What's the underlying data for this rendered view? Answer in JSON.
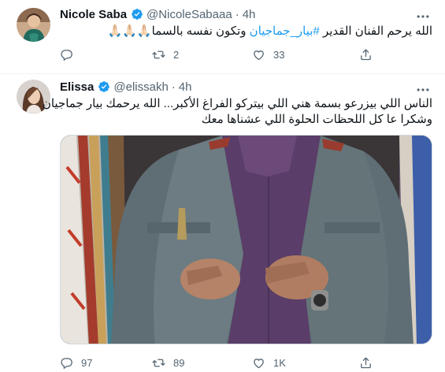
{
  "tweets": [
    {
      "name": "Nicole Saba",
      "handle": "@NicoleSabaaa",
      "dot": "·",
      "time": "4h",
      "text_plain": "الله يرحم الفنان القدير ",
      "hashtag": "#بيار_جماجيان",
      "text_after": " وتكون نفسه بالسما🙏🏻🙏🏻🙏🏻",
      "replies": "",
      "retweets": "2",
      "likes": "33"
    },
    {
      "name": "Elissa",
      "handle": "@elissakh",
      "dot": "·",
      "time": "4h",
      "line1": "الناس اللي بيزرعو بسمة هني اللي بيتركو الفراغ الأكبر... الله يرحمك بيار جماجيان",
      "line2": "وشكرا عا كل اللحظات الحلوة اللي عشناها معك",
      "replies": "97",
      "retweets": "89",
      "likes": "1K"
    }
  ],
  "colors": {
    "accent": "#1d9bf0",
    "secondary_text": "#536471",
    "verified": "#1d9bf0"
  },
  "icons": {
    "reply": "reply-icon",
    "retweet": "retweet-icon",
    "like": "heart-icon",
    "share": "share-icon",
    "more": "more-icon",
    "verified": "verified-badge-icon"
  }
}
